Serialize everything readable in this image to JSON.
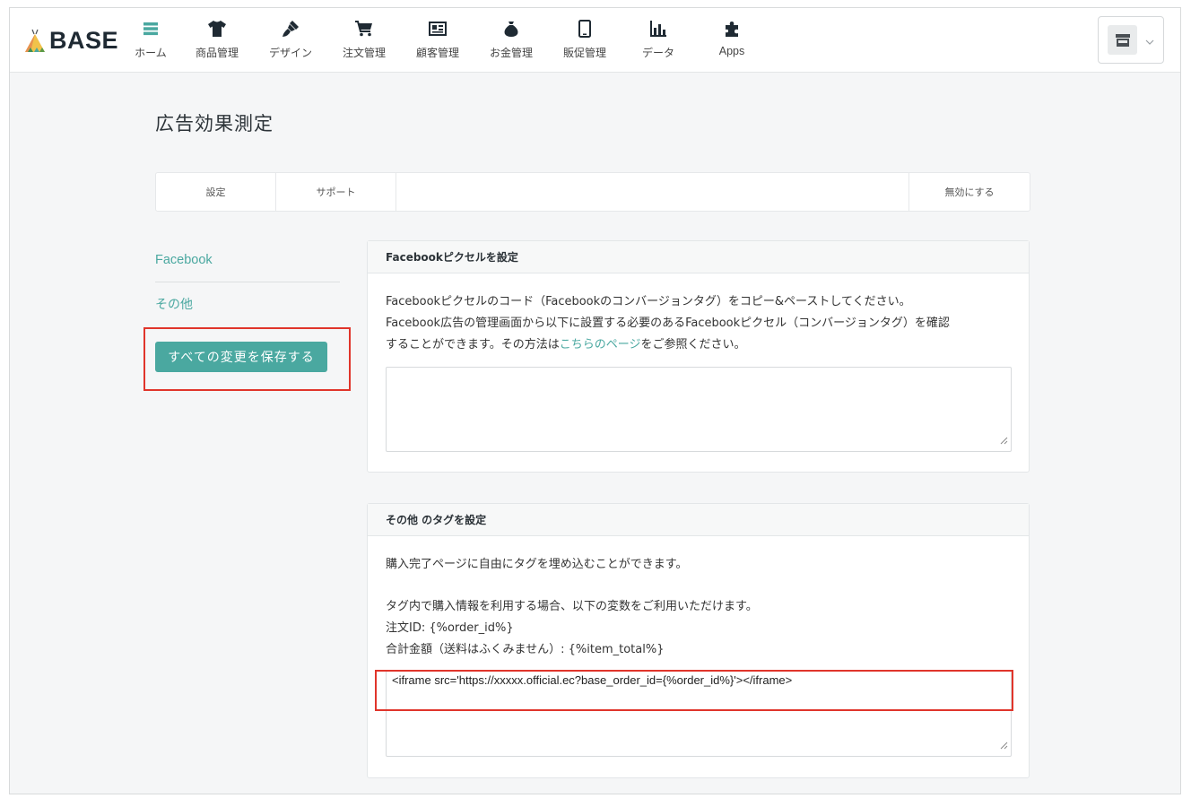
{
  "app": {
    "logo_text": "BASE"
  },
  "nav": [
    {
      "label": "ホーム",
      "icon": "list-icon"
    },
    {
      "label": "商品管理",
      "icon": "tshirt-icon"
    },
    {
      "label": "デザイン",
      "icon": "brush-icon"
    },
    {
      "label": "注文管理",
      "icon": "cart-icon"
    },
    {
      "label": "顧客管理",
      "icon": "id-card-icon"
    },
    {
      "label": "お金管理",
      "icon": "money-bag-icon"
    },
    {
      "label": "販促管理",
      "icon": "smartphone-icon"
    },
    {
      "label": "データ",
      "icon": "bar-chart-icon"
    },
    {
      "label": "Apps",
      "icon": "puzzle-icon"
    }
  ],
  "shop_menu": {
    "icon": "store-icon",
    "caret": "chevron-down-icon"
  },
  "page": {
    "title": "広告効果測定"
  },
  "tabs": {
    "settings": "設定",
    "support": "サポート",
    "disable": "無効にする"
  },
  "sidebar": {
    "items": [
      {
        "label": "Facebook"
      },
      {
        "label": "その他"
      }
    ],
    "save_label": "すべての変更を保存する"
  },
  "facebook_panel": {
    "title": "Facebookピクセルを設定",
    "desc_line1": "Facebookピクセルのコード（Facebookのコンバージョンタグ）をコピー&ペーストしてください。",
    "desc_line2": "Facebook広告の管理画面から以下に設置する必要のあるFacebookピクセル（コンバージョンタグ）を確認",
    "desc_line3_pre": "することができます。その方法は",
    "desc_link": "こちらのページ",
    "desc_line3_post": "をご参照ください。",
    "textarea_value": ""
  },
  "other_panel": {
    "title": "その他 のタグを設定",
    "line1": "購入完了ページに自由にタグを埋め込むことができます。",
    "line2": "タグ内で購入情報を利用する場合、以下の変数をご利用いただけます。",
    "line3": "注文ID: {%order_id%}",
    "line4": "合計金額（送料はふくみません）: {%item_total%}",
    "textarea_value": "<iframe src='https://xxxxx.official.ec?base_order_id={%order_id%}'></iframe>"
  },
  "colors": {
    "accent": "#4aa8a0",
    "highlight": "#e0352b",
    "background": "#f5f6f7"
  }
}
